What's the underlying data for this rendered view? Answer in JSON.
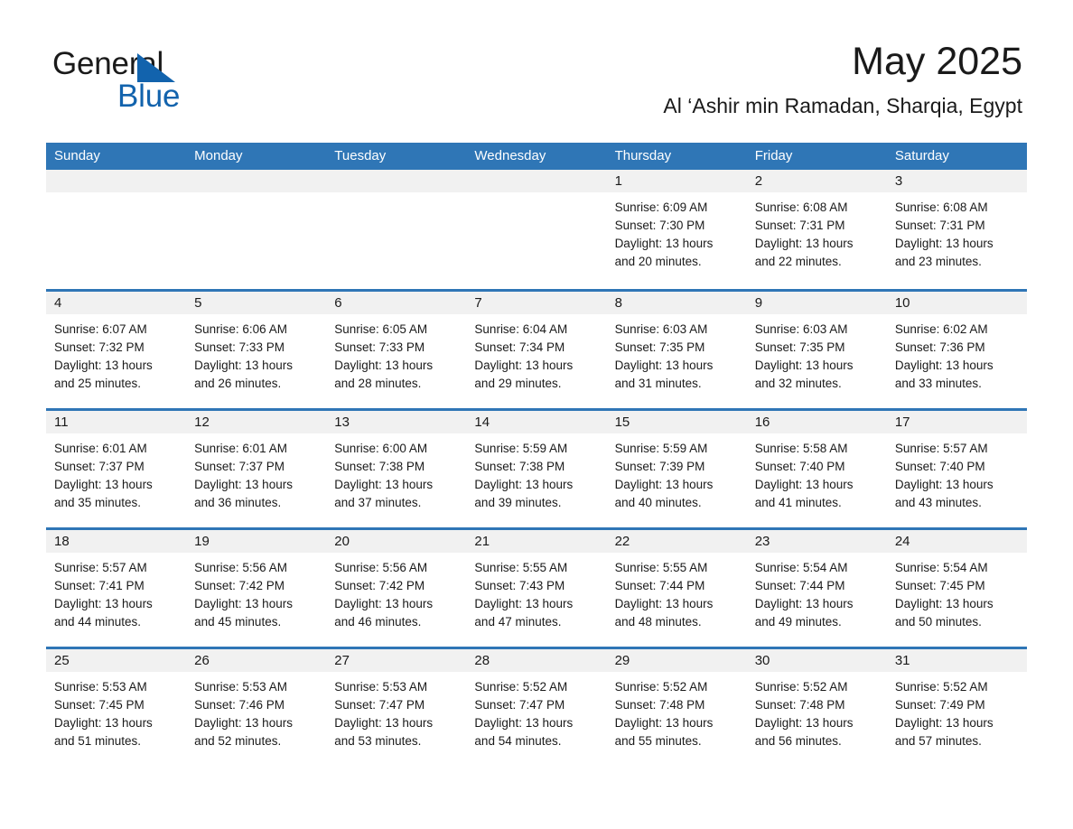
{
  "brand": {
    "name_part1": "General",
    "name_part2": "Blue",
    "accent_color": "#1263ad",
    "triangle_icon": "brand-triangle-icon"
  },
  "header": {
    "month_title": "May 2025",
    "location": "Al ‘Ashir min Ramadan, Sharqia, Egypt"
  },
  "calendar": {
    "header_bg": "#2f76b6",
    "day_band_bg": "#f1f1f1",
    "weekdays": [
      "Sunday",
      "Monday",
      "Tuesday",
      "Wednesday",
      "Thursday",
      "Friday",
      "Saturday"
    ],
    "weeks": [
      [
        {
          "day": "",
          "sunrise": "",
          "sunset": "",
          "daylight": "",
          "daylight2": ""
        },
        {
          "day": "",
          "sunrise": "",
          "sunset": "",
          "daylight": "",
          "daylight2": ""
        },
        {
          "day": "",
          "sunrise": "",
          "sunset": "",
          "daylight": "",
          "daylight2": ""
        },
        {
          "day": "",
          "sunrise": "",
          "sunset": "",
          "daylight": "",
          "daylight2": ""
        },
        {
          "day": "1",
          "sunrise": "Sunrise: 6:09 AM",
          "sunset": "Sunset: 7:30 PM",
          "daylight": "Daylight: 13 hours",
          "daylight2": "and 20 minutes."
        },
        {
          "day": "2",
          "sunrise": "Sunrise: 6:08 AM",
          "sunset": "Sunset: 7:31 PM",
          "daylight": "Daylight: 13 hours",
          "daylight2": "and 22 minutes."
        },
        {
          "day": "3",
          "sunrise": "Sunrise: 6:08 AM",
          "sunset": "Sunset: 7:31 PM",
          "daylight": "Daylight: 13 hours",
          "daylight2": "and 23 minutes."
        }
      ],
      [
        {
          "day": "4",
          "sunrise": "Sunrise: 6:07 AM",
          "sunset": "Sunset: 7:32 PM",
          "daylight": "Daylight: 13 hours",
          "daylight2": "and 25 minutes."
        },
        {
          "day": "5",
          "sunrise": "Sunrise: 6:06 AM",
          "sunset": "Sunset: 7:33 PM",
          "daylight": "Daylight: 13 hours",
          "daylight2": "and 26 minutes."
        },
        {
          "day": "6",
          "sunrise": "Sunrise: 6:05 AM",
          "sunset": "Sunset: 7:33 PM",
          "daylight": "Daylight: 13 hours",
          "daylight2": "and 28 minutes."
        },
        {
          "day": "7",
          "sunrise": "Sunrise: 6:04 AM",
          "sunset": "Sunset: 7:34 PM",
          "daylight": "Daylight: 13 hours",
          "daylight2": "and 29 minutes."
        },
        {
          "day": "8",
          "sunrise": "Sunrise: 6:03 AM",
          "sunset": "Sunset: 7:35 PM",
          "daylight": "Daylight: 13 hours",
          "daylight2": "and 31 minutes."
        },
        {
          "day": "9",
          "sunrise": "Sunrise: 6:03 AM",
          "sunset": "Sunset: 7:35 PM",
          "daylight": "Daylight: 13 hours",
          "daylight2": "and 32 minutes."
        },
        {
          "day": "10",
          "sunrise": "Sunrise: 6:02 AM",
          "sunset": "Sunset: 7:36 PM",
          "daylight": "Daylight: 13 hours",
          "daylight2": "and 33 minutes."
        }
      ],
      [
        {
          "day": "11",
          "sunrise": "Sunrise: 6:01 AM",
          "sunset": "Sunset: 7:37 PM",
          "daylight": "Daylight: 13 hours",
          "daylight2": "and 35 minutes."
        },
        {
          "day": "12",
          "sunrise": "Sunrise: 6:01 AM",
          "sunset": "Sunset: 7:37 PM",
          "daylight": "Daylight: 13 hours",
          "daylight2": "and 36 minutes."
        },
        {
          "day": "13",
          "sunrise": "Sunrise: 6:00 AM",
          "sunset": "Sunset: 7:38 PM",
          "daylight": "Daylight: 13 hours",
          "daylight2": "and 37 minutes."
        },
        {
          "day": "14",
          "sunrise": "Sunrise: 5:59 AM",
          "sunset": "Sunset: 7:38 PM",
          "daylight": "Daylight: 13 hours",
          "daylight2": "and 39 minutes."
        },
        {
          "day": "15",
          "sunrise": "Sunrise: 5:59 AM",
          "sunset": "Sunset: 7:39 PM",
          "daylight": "Daylight: 13 hours",
          "daylight2": "and 40 minutes."
        },
        {
          "day": "16",
          "sunrise": "Sunrise: 5:58 AM",
          "sunset": "Sunset: 7:40 PM",
          "daylight": "Daylight: 13 hours",
          "daylight2": "and 41 minutes."
        },
        {
          "day": "17",
          "sunrise": "Sunrise: 5:57 AM",
          "sunset": "Sunset: 7:40 PM",
          "daylight": "Daylight: 13 hours",
          "daylight2": "and 43 minutes."
        }
      ],
      [
        {
          "day": "18",
          "sunrise": "Sunrise: 5:57 AM",
          "sunset": "Sunset: 7:41 PM",
          "daylight": "Daylight: 13 hours",
          "daylight2": "and 44 minutes."
        },
        {
          "day": "19",
          "sunrise": "Sunrise: 5:56 AM",
          "sunset": "Sunset: 7:42 PM",
          "daylight": "Daylight: 13 hours",
          "daylight2": "and 45 minutes."
        },
        {
          "day": "20",
          "sunrise": "Sunrise: 5:56 AM",
          "sunset": "Sunset: 7:42 PM",
          "daylight": "Daylight: 13 hours",
          "daylight2": "and 46 minutes."
        },
        {
          "day": "21",
          "sunrise": "Sunrise: 5:55 AM",
          "sunset": "Sunset: 7:43 PM",
          "daylight": "Daylight: 13 hours",
          "daylight2": "and 47 minutes."
        },
        {
          "day": "22",
          "sunrise": "Sunrise: 5:55 AM",
          "sunset": "Sunset: 7:44 PM",
          "daylight": "Daylight: 13 hours",
          "daylight2": "and 48 minutes."
        },
        {
          "day": "23",
          "sunrise": "Sunrise: 5:54 AM",
          "sunset": "Sunset: 7:44 PM",
          "daylight": "Daylight: 13 hours",
          "daylight2": "and 49 minutes."
        },
        {
          "day": "24",
          "sunrise": "Sunrise: 5:54 AM",
          "sunset": "Sunset: 7:45 PM",
          "daylight": "Daylight: 13 hours",
          "daylight2": "and 50 minutes."
        }
      ],
      [
        {
          "day": "25",
          "sunrise": "Sunrise: 5:53 AM",
          "sunset": "Sunset: 7:45 PM",
          "daylight": "Daylight: 13 hours",
          "daylight2": "and 51 minutes."
        },
        {
          "day": "26",
          "sunrise": "Sunrise: 5:53 AM",
          "sunset": "Sunset: 7:46 PM",
          "daylight": "Daylight: 13 hours",
          "daylight2": "and 52 minutes."
        },
        {
          "day": "27",
          "sunrise": "Sunrise: 5:53 AM",
          "sunset": "Sunset: 7:47 PM",
          "daylight": "Daylight: 13 hours",
          "daylight2": "and 53 minutes."
        },
        {
          "day": "28",
          "sunrise": "Sunrise: 5:52 AM",
          "sunset": "Sunset: 7:47 PM",
          "daylight": "Daylight: 13 hours",
          "daylight2": "and 54 minutes."
        },
        {
          "day": "29",
          "sunrise": "Sunrise: 5:52 AM",
          "sunset": "Sunset: 7:48 PM",
          "daylight": "Daylight: 13 hours",
          "daylight2": "and 55 minutes."
        },
        {
          "day": "30",
          "sunrise": "Sunrise: 5:52 AM",
          "sunset": "Sunset: 7:48 PM",
          "daylight": "Daylight: 13 hours",
          "daylight2": "and 56 minutes."
        },
        {
          "day": "31",
          "sunrise": "Sunrise: 5:52 AM",
          "sunset": "Sunset: 7:49 PM",
          "daylight": "Daylight: 13 hours",
          "daylight2": "and 57 minutes."
        }
      ]
    ]
  }
}
